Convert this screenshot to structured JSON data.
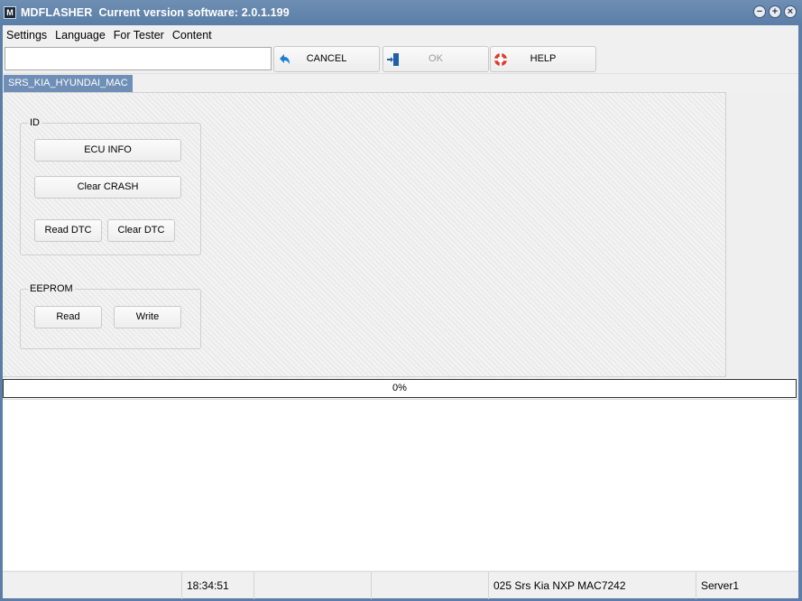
{
  "window": {
    "app_name": "MDFLASHER",
    "version_text": "Current version software: 2.0.1.199",
    "controls": [
      "−",
      "+",
      "×"
    ]
  },
  "menu": [
    "Settings",
    "Language",
    "For Tester",
    "Content"
  ],
  "toolbar": {
    "input_value": "",
    "cancel_label": "CANCEL",
    "ok_label": "OK",
    "help_label": "HELP",
    "icons": {
      "cancel": "undo-arrow-icon",
      "ok": "exit-door-icon",
      "help": "lifebuoy-icon"
    },
    "colors": {
      "cancel_icon": "#1a7fd4",
      "ok_icon": "#1f5fa8",
      "help_icon": "#e03a2f"
    }
  },
  "tab": {
    "label": "SRS_KIA_HYUNDAI_MAC"
  },
  "groups": {
    "id": {
      "title": "ID",
      "ecu_info": "ECU INFO",
      "clear_crash": "Clear CRASH",
      "read_dtc": "Read DTC",
      "clear_dtc": "Clear DTC"
    },
    "eeprom": {
      "title": "EEPROM",
      "read": "Read",
      "write": "Write"
    }
  },
  "progress": {
    "value": 0,
    "label": "0%"
  },
  "status": {
    "time": "18:34:51",
    "module": "025 Srs Kia NXP MAC7242",
    "server": "Server1"
  },
  "colors": {
    "title_bar": "#5a7ea7",
    "tab": "#6f8fb6"
  }
}
